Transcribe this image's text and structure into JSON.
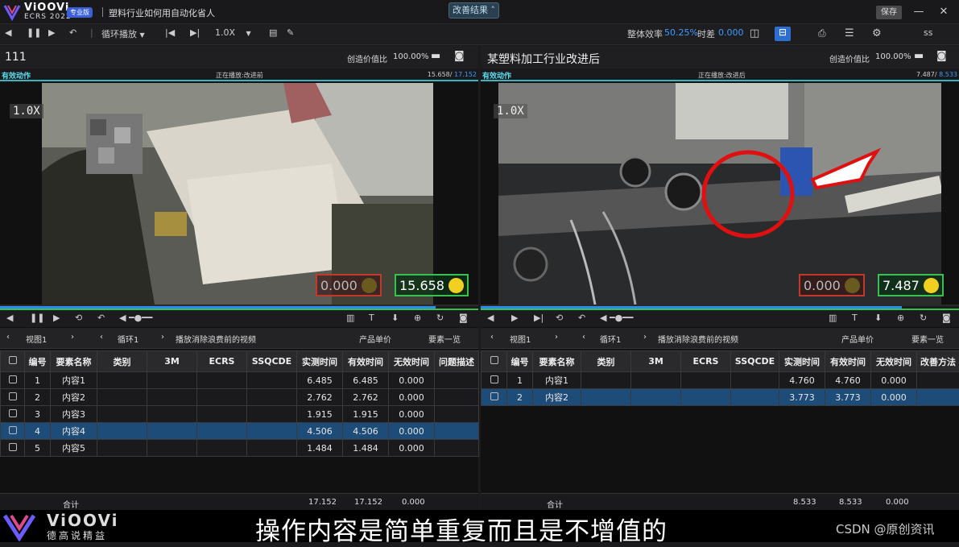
{
  "app": {
    "brand": "ViOOVi",
    "brand_sub": "ECRS 2022",
    "edition": "专业版",
    "doc_title": "塑料行业如何用自动化省人",
    "mode_button": "改善结果",
    "save": "保存"
  },
  "toolbar": {
    "loop": "循环播放",
    "speed": "1.0X",
    "efficiency_label": "整体效率",
    "efficiency_value": "50.25%",
    "diff_label": "时差",
    "diff_value": "0.000",
    "user": "ss"
  },
  "left": {
    "title": "111",
    "ratio_label": "创造价值比",
    "ratio_value": "100.00%",
    "effective": "有效动作",
    "playing": "正在播放:改进前",
    "time_current": "15.658",
    "time_total": "17.152",
    "speed_overlay": "1.0X",
    "badge_gray": "0.000",
    "badge_green": "15.658",
    "progress": 0.91,
    "tabs": {
      "view": "视图1",
      "loop": "循环1",
      "play": "播放消除浪费前的视频",
      "unit_price": "产品单价",
      "elements": "要素一览"
    },
    "columns": [
      "编号",
      "要素名称",
      "类别",
      "3M",
      "ECRS",
      "SSQCDE",
      "实测时间",
      "有效时间",
      "无效时间",
      "问题描述"
    ],
    "rows": [
      {
        "no": "1",
        "name": "内容1",
        "measured": "6.485",
        "effective": "6.485",
        "invalid": "0.000"
      },
      {
        "no": "2",
        "name": "内容2",
        "measured": "2.762",
        "effective": "2.762",
        "invalid": "0.000"
      },
      {
        "no": "3",
        "name": "内容3",
        "measured": "1.915",
        "effective": "1.915",
        "invalid": "0.000"
      },
      {
        "no": "4",
        "name": "内容4",
        "measured": "4.506",
        "effective": "4.506",
        "invalid": "0.000"
      },
      {
        "no": "5",
        "name": "内容5",
        "measured": "1.484",
        "effective": "1.484",
        "invalid": "0.000"
      }
    ],
    "total": {
      "label": "合计",
      "measured": "17.152",
      "effective": "17.152",
      "invalid": "0.000"
    }
  },
  "right": {
    "title": "某塑料加工行业改进后",
    "ratio_label": "创造价值比",
    "ratio_value": "100.00%",
    "effective": "有效动作",
    "playing": "正在播放:改进后",
    "time_current": "7.487",
    "time_total": "8.533",
    "speed_overlay": "1.0X",
    "badge_gray": "0.000",
    "badge_green": "7.487",
    "progress": 0.88,
    "tabs": {
      "view": "视图1",
      "loop": "循环1",
      "play": "播放消除浪费前的视频",
      "unit_price": "产品单价",
      "elements": "要素一览"
    },
    "columns": [
      "编号",
      "要素名称",
      "类别",
      "3M",
      "ECRS",
      "SSQCDE",
      "实测时间",
      "有效时间",
      "无效时间",
      "改善方法"
    ],
    "rows": [
      {
        "no": "1",
        "name": "内容1",
        "measured": "4.760",
        "effective": "4.760",
        "invalid": "0.000"
      },
      {
        "no": "2",
        "name": "内容2",
        "measured": "3.773",
        "effective": "3.773",
        "invalid": "0.000"
      }
    ],
    "total": {
      "label": "合计",
      "measured": "8.533",
      "effective": "8.533",
      "invalid": "0.000"
    }
  },
  "footer": {
    "brand": "ViOOVi",
    "brand_sub": "德高说精益",
    "caption": "操作内容是简单重复而且是不增值的",
    "watermark": "CSDN @原创资讯"
  },
  "colors": {
    "accent": "#3a9bff",
    "selected_row": "#1d4c78",
    "effective_label": "#5be0f2",
    "badge_green": "#3ac050",
    "badge_red": "#c0392b"
  }
}
